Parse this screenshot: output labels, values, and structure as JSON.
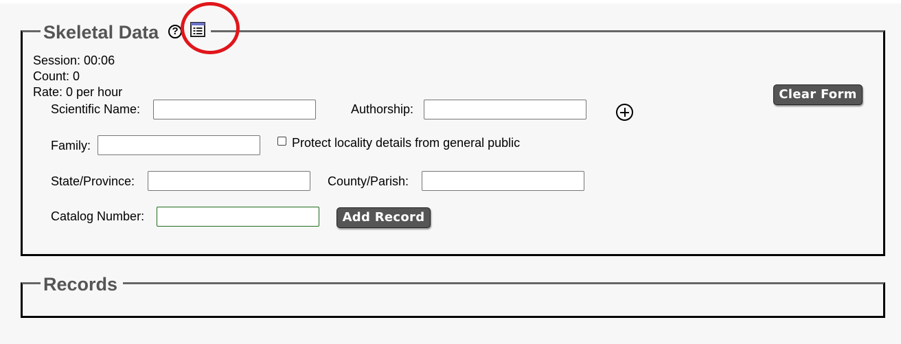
{
  "skeletal": {
    "title": "Skeletal Data",
    "help_symbol": "?",
    "stats": {
      "session": "Session: 00:06",
      "count": "Count: 0",
      "rate": "Rate: 0 per hour"
    },
    "clear_form_label": "Clear Form",
    "fields": {
      "scientific_name": {
        "label": "Scientific Name:",
        "value": ""
      },
      "authorship": {
        "label": "Authorship:",
        "value": ""
      },
      "family": {
        "label": "Family:",
        "value": ""
      },
      "state_province": {
        "label": "State/Province:",
        "value": ""
      },
      "county_parish": {
        "label": "County/Parish:",
        "value": ""
      },
      "catalog_number": {
        "label": "Catalog Number:",
        "value": ""
      }
    },
    "protect_locality": {
      "label": "Protect locality details from general public",
      "checked": false
    },
    "add_record_label": "Add Record"
  },
  "records": {
    "title": "Records"
  },
  "icons": {
    "help": "help-circle-icon",
    "table": "table-list-icon",
    "add_taxon": "plus-circle-icon"
  },
  "colors": {
    "highlight_circle": "#e0161b",
    "button_bg": "#555555",
    "legend_text": "#555555",
    "focus_border": "#1d6b1d"
  }
}
